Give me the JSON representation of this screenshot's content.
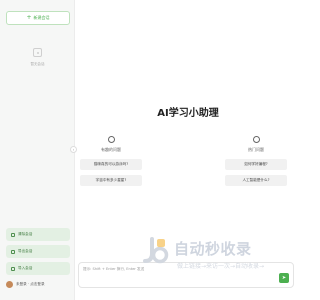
{
  "sidebar": {
    "new_chat_label": "新建会话",
    "empty_text": "暂无会话",
    "buttons": [
      {
        "label": "清除会话"
      },
      {
        "label": "导出会话"
      },
      {
        "label": "导入会话"
      }
    ],
    "user_name": "未登录 · 点击登录"
  },
  "main": {
    "title": "AI学习小助理",
    "left_column": {
      "label": "有趣的问题",
      "suggestions": [
        "猫咪真的可以游泳吗?",
        "宇宙中有多少星星?"
      ]
    },
    "right_column": {
      "label": "热门问题",
      "suggestions": [
        "如何学好编程?",
        "人工智能是什么?"
      ]
    },
    "input_placeholder": "提示: Shift + Enter 换行, Enter 发送",
    "send_icon": "send-icon"
  },
  "watermark": {
    "big_text": "自动秒收录",
    "small_text": "做上链接→来访一次→自动收录→"
  },
  "colors": {
    "accent": "#4caf50",
    "sidebar_button_bg": "#e3f0e3"
  }
}
